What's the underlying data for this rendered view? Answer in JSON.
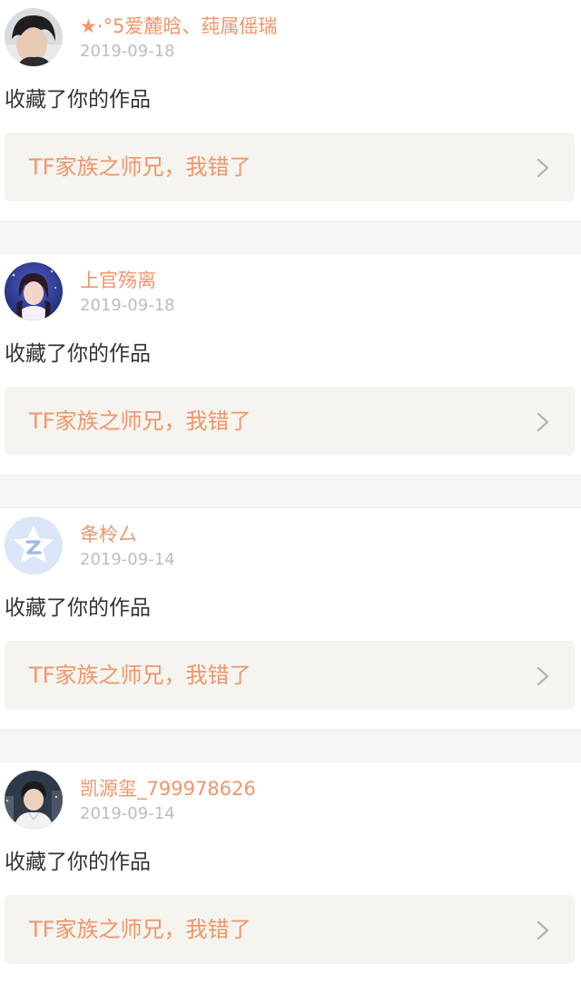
{
  "colors": {
    "accent": "#f0956a",
    "date": "#bdbdbd",
    "card_bg": "#f5f4ef",
    "separator": "#f6f6f6",
    "text": "#333333"
  },
  "notifications": [
    {
      "avatar": "dark-haired-boy-avatar",
      "username": "★·°5爱麓晗、莼属傜瑞",
      "date": "2019-09-18",
      "action": "收藏了你的作品",
      "work_title": "TF家族之师兄，我错了",
      "chevron": "chevron-right-icon"
    },
    {
      "avatar": "girl-stage-avatar",
      "username": "上官殇离",
      "date": "2019-09-18",
      "action": "收藏了你的作品",
      "work_title": "TF家族之师兄，我错了",
      "chevron": "chevron-right-icon"
    },
    {
      "avatar": "default-q-star-avatar",
      "username": "夅柃厶",
      "date": "2019-09-14",
      "action": "收藏了你的作品",
      "work_title": "TF家族之师兄，我错了",
      "chevron": "chevron-right-icon"
    },
    {
      "avatar": "boy-city-avatar",
      "username": "凯源玺_799978626",
      "date": "2019-09-14",
      "action": "收藏了你的作品",
      "work_title": "TF家族之师兄，我错了",
      "chevron": "chevron-right-icon"
    }
  ]
}
